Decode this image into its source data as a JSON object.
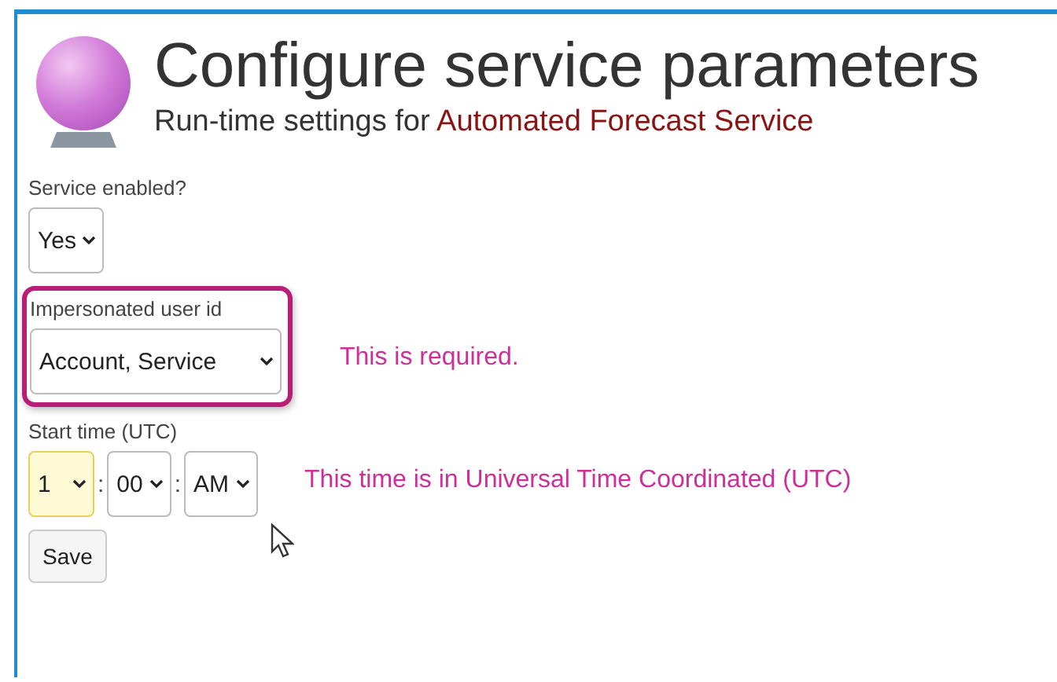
{
  "header": {
    "title": "Configure service parameters",
    "subtitle": "Run-time settings for",
    "service_name": "Automated Forecast Service"
  },
  "fields": [
    {
      "kind": "select",
      "label": "Service enabled?",
      "value": "Yes",
      "highlighted": false
    },
    {
      "kind": "select",
      "label": "Impersonated user id",
      "value": "Account, Service",
      "highlighted": true,
      "note": "This is required."
    },
    {
      "kind": "time",
      "label": "Start time (UTC)",
      "parts": [
        {
          "value": "1",
          "focused": true
        },
        {
          "value": "00",
          "focused": false
        },
        {
          "value": "AM",
          "focused": false
        }
      ],
      "separator": ":",
      "note": "This time is in Universal Time Coordinated (UTC)"
    }
  ],
  "buttons": [
    "Save"
  ]
}
